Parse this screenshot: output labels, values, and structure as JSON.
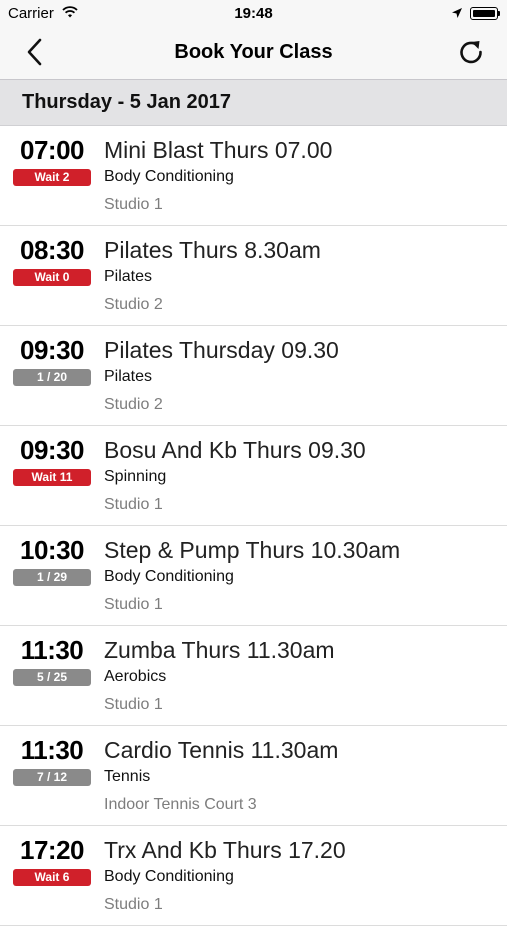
{
  "status_bar": {
    "carrier": "Carrier",
    "time": "19:48"
  },
  "nav": {
    "title": "Book Your Class",
    "back_icon": "chevron-left-icon",
    "refresh_icon": "refresh-icon"
  },
  "date_header": "Thursday - 5 Jan 2017",
  "colors": {
    "wait_badge": "#d0202a",
    "count_badge": "#8a8a8a"
  },
  "classes": [
    {
      "time": "07:00",
      "badge": "Wait 2",
      "badge_type": "wait",
      "name": "Mini Blast Thurs 07.00",
      "type": "Body Conditioning",
      "location": "Studio 1"
    },
    {
      "time": "08:30",
      "badge": "Wait 0",
      "badge_type": "wait",
      "name": "Pilates Thurs 8.30am",
      "type": "Pilates",
      "location": "Studio 2"
    },
    {
      "time": "09:30",
      "badge": "1 / 20",
      "badge_type": "count",
      "name": "Pilates Thursday 09.30",
      "type": "Pilates",
      "location": "Studio 2"
    },
    {
      "time": "09:30",
      "badge": "Wait 11",
      "badge_type": "wait",
      "name": "Bosu And Kb Thurs 09.30",
      "type": "Spinning",
      "location": "Studio 1"
    },
    {
      "time": "10:30",
      "badge": "1 / 29",
      "badge_type": "count",
      "name": "Step & Pump Thurs 10.30am",
      "type": "Body Conditioning",
      "location": "Studio 1"
    },
    {
      "time": "11:30",
      "badge": "5 / 25",
      "badge_type": "count",
      "name": "Zumba Thurs 11.30am",
      "type": "Aerobics",
      "location": "Studio 1"
    },
    {
      "time": "11:30",
      "badge": "7 / 12",
      "badge_type": "count",
      "name": "Cardio Tennis 11.30am",
      "type": "Tennis",
      "location": "Indoor Tennis Court 3"
    },
    {
      "time": "17:20",
      "badge": "Wait 6",
      "badge_type": "wait",
      "name": "Trx And Kb Thurs 17.20",
      "type": "Body Conditioning",
      "location": "Studio 1"
    }
  ]
}
